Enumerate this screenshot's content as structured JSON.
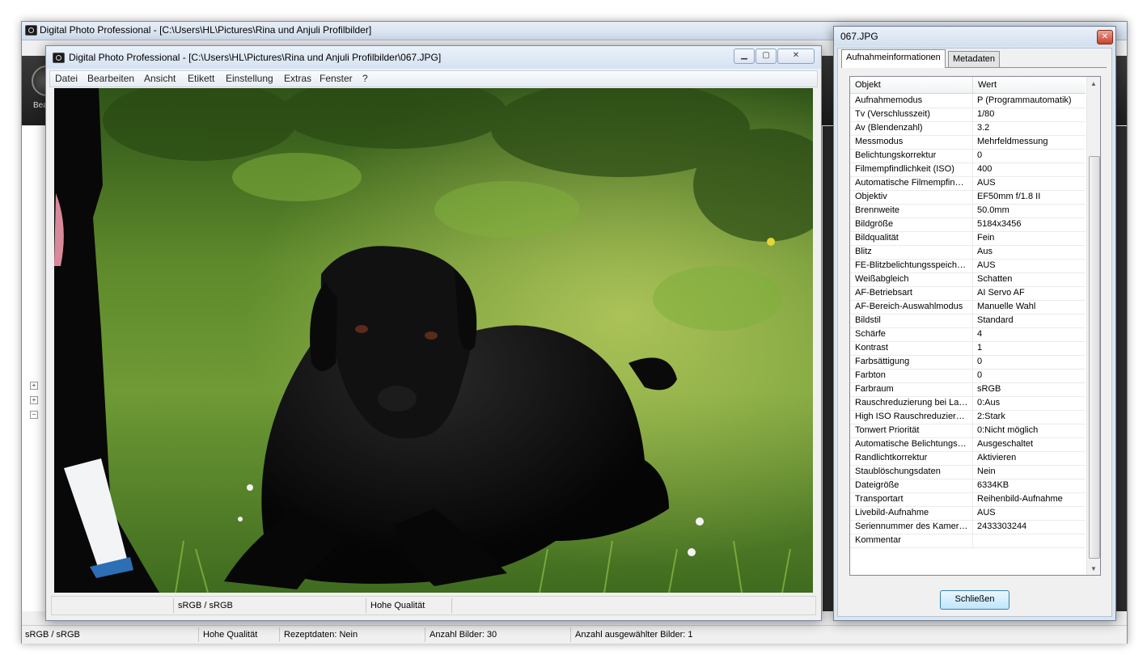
{
  "main": {
    "title": "Digital Photo Professional - [C:\\Users\\HL\\Pictures\\Rina und Anjuli Profilbilder]",
    "toolbar_label": "Bea fe",
    "status": {
      "color_space": "sRGB / sRGB",
      "quality": "Hohe Qualität",
      "recipe": "Rezeptdaten: Nein",
      "count": "Anzahl Bilder: 30",
      "selected": "Anzahl ausgewählter Bilder: 1"
    }
  },
  "viewer": {
    "title": "Digital Photo Professional - [C:\\Users\\HL\\Pictures\\Rina und Anjuli Profilbilder\\067.JPG]",
    "menu": [
      "Datei",
      "Bearbeiten",
      "Ansicht",
      "Etikett",
      "Einstellung",
      "Extras",
      "Fenster",
      "?"
    ],
    "status": {
      "color_space": "sRGB / sRGB",
      "quality": "Hohe Qualität"
    }
  },
  "info": {
    "title": "067.JPG",
    "tabs": [
      "Aufnahmeinformationen",
      "Metadaten"
    ],
    "columns": [
      "Objekt",
      "Wert"
    ],
    "rows": [
      [
        "Aufnahmemodus",
        "P (Programmautomatik)"
      ],
      [
        "Tv (Verschlusszeit)",
        "1/80"
      ],
      [
        "Av (Blendenzahl)",
        "3.2"
      ],
      [
        "Messmodus",
        "Mehrfeldmessung"
      ],
      [
        "Belichtungskorrektur",
        "0"
      ],
      [
        "Filmempfindlichkeit (ISO)",
        "400"
      ],
      [
        "Automatische Filmempfindli...",
        "AUS"
      ],
      [
        "Objektiv",
        "EF50mm f/1.8 II"
      ],
      [
        "Brennweite",
        "50.0mm"
      ],
      [
        "Bildgröße",
        "5184x3456"
      ],
      [
        "Bildqualität",
        "Fein"
      ],
      [
        "Blitz",
        "Aus"
      ],
      [
        "FE-Blitzbelichtungsspeicher...",
        "AUS"
      ],
      [
        "Weißabgleich",
        "Schatten"
      ],
      [
        "AF-Betriebsart",
        "AI Servo AF"
      ],
      [
        "AF-Bereich-Auswahlmodus",
        "Manuelle Wahl"
      ],
      [
        "Bildstil",
        "Standard"
      ],
      [
        "Schärfe",
        "4"
      ],
      [
        "Kontrast",
        "1"
      ],
      [
        "Farbsättigung",
        "0"
      ],
      [
        "Farbton",
        "0"
      ],
      [
        "Farbraum",
        "sRGB"
      ],
      [
        "Rauschreduzierung bei Lan...",
        "0:Aus"
      ],
      [
        "High ISO Rauschreduzierung",
        "2:Stark"
      ],
      [
        "Tonwert Priorität",
        "0:Nicht möglich"
      ],
      [
        "Automatische Belichtungso...",
        "Ausgeschaltet"
      ],
      [
        "Randlichtkorrektur",
        "Aktivieren"
      ],
      [
        "Staublöschungsdaten",
        "Nein"
      ],
      [
        "Dateigröße",
        "6334KB"
      ],
      [
        "Transportart",
        "Reihenbild-Aufnahme"
      ],
      [
        "Livebild-Aufnahme",
        "AUS"
      ],
      [
        "Seriennummer des Kamera...",
        "2433303244"
      ],
      [
        "Kommentar",
        ""
      ]
    ],
    "close_label": "Schließen"
  },
  "colors": {
    "titlebar": "#d6e2f1",
    "grass": "#5f8f2a",
    "dog": "#0b0b0b",
    "dialog_button": "#bee6fd"
  }
}
